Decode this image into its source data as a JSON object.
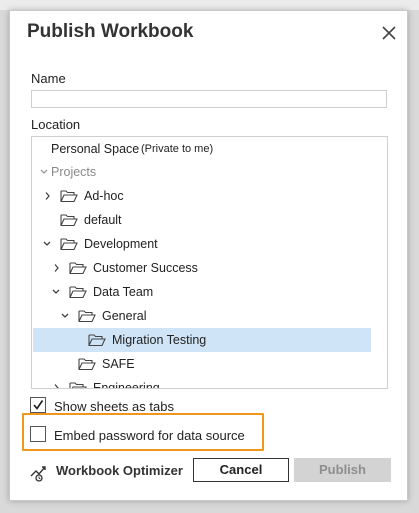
{
  "dialog": {
    "title": "Publish Workbook",
    "name_label": "Name",
    "name_value": "",
    "location_label": "Location"
  },
  "tree": {
    "personal_space": "Personal Space",
    "personal_space_note": "(Private to me)",
    "projects_header": "Projects",
    "items": [
      {
        "label": "Ad-hoc",
        "depth": 0,
        "chevron": "right"
      },
      {
        "label": "default",
        "depth": 0,
        "chevron": "none"
      },
      {
        "label": "Development",
        "depth": 0,
        "chevron": "down"
      },
      {
        "label": "Customer Success",
        "depth": 1,
        "chevron": "right"
      },
      {
        "label": "Data Team",
        "depth": 1,
        "chevron": "down"
      },
      {
        "label": "General",
        "depth": 2,
        "chevron": "down"
      },
      {
        "label": "Migration Testing",
        "depth": 3,
        "chevron": "none",
        "selected": true
      },
      {
        "label": "SAFE",
        "depth": 2,
        "chevron": "none"
      },
      {
        "label": "Engineering",
        "depth": 1,
        "chevron": "right"
      }
    ]
  },
  "options": {
    "show_sheets_label": "Show sheets as tabs",
    "show_sheets_checked": true,
    "embed_password_label": "Embed password for data source",
    "embed_password_checked": false
  },
  "footer": {
    "optimizer_label": "Workbook Optimizer",
    "cancel_label": "Cancel",
    "publish_label": "Publish",
    "publish_enabled": false
  },
  "colors": {
    "highlight": "#f0961e",
    "selected_row": "#cfe5f7"
  }
}
